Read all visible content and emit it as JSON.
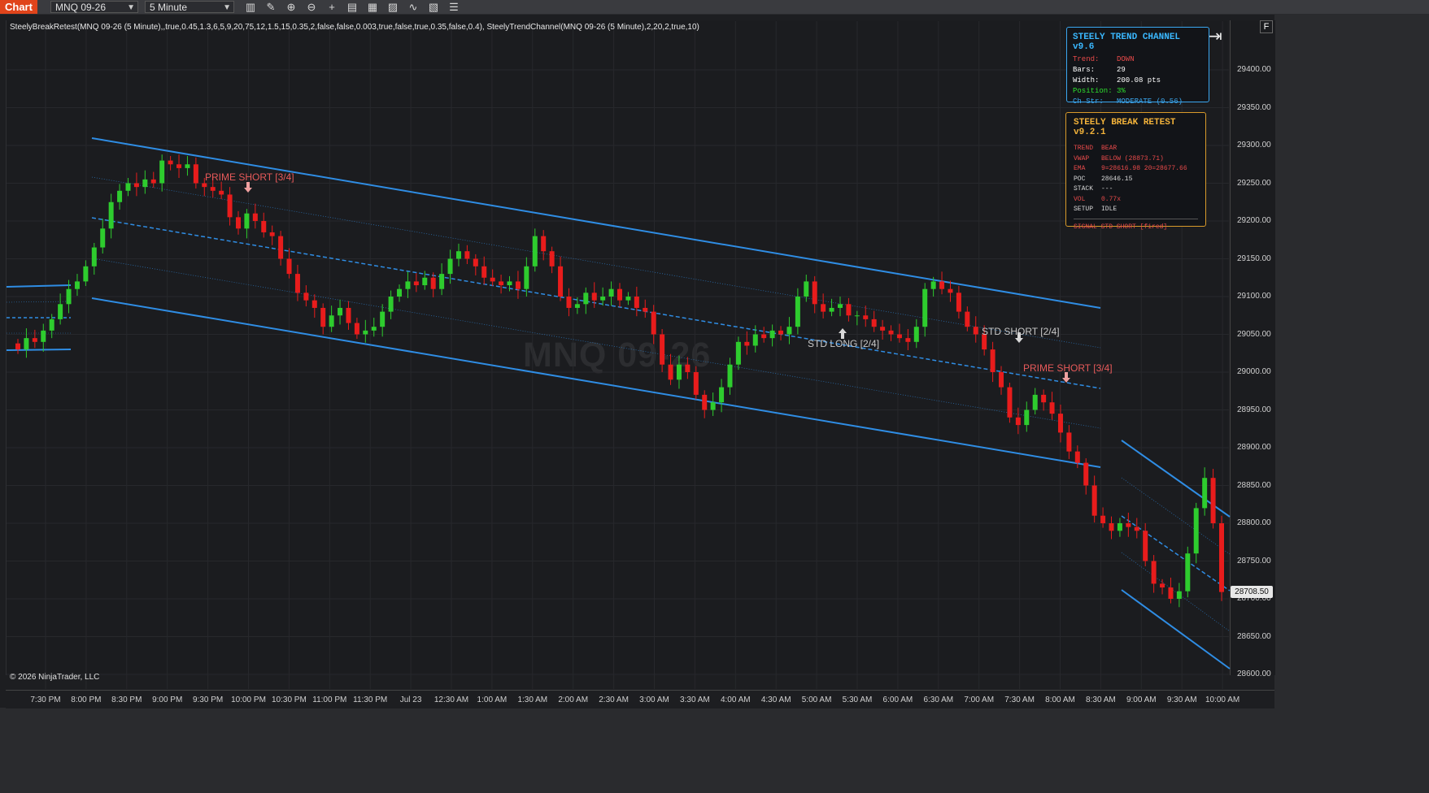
{
  "toolbar": {
    "chart_tab": "Chart",
    "instrument": "MNQ 09-26",
    "interval": "5 Minute",
    "icons": [
      "bars-type-icon",
      "draw-pencil-icon",
      "zoom-in-icon",
      "zoom-out-icon",
      "crosshair-icon",
      "data-box-icon",
      "templates-icon",
      "strategies-icon",
      "indicators-icon",
      "properties-icon",
      "menu-icon"
    ]
  },
  "chart": {
    "indicator_params": "SteelyBreakRetest(MNQ 09-26 (5 Minute),,true,0.45,1.3,6,5,9,20,75,12,1.5,15,0.35,2,false,false,0.003,true,false,true,0.35,false,0.4), SteelyTrendChannel(MNQ 09-26 (5 Minute),2,20,2,true,10)",
    "watermark": "MNQ 09-26",
    "copyright": "© 2026 NinjaTrader, LLC",
    "f_button": "F",
    "current_price": "28708.50"
  },
  "colors": {
    "bull": "#2ecc2e",
    "bear": "#e81c1c",
    "channel": "#2f8de4",
    "trend_panel_border": "#3aa7f0",
    "break_panel_border": "#d89a2a"
  },
  "trend_channel_panel": {
    "title": "STEELY TREND CHANNEL v9.6",
    "rows": [
      {
        "key": "Trend:",
        "value": "DOWN",
        "color": "#e84a4a"
      },
      {
        "key": "Bars:",
        "value": "29",
        "color": "#ffffff"
      },
      {
        "key": "Width:",
        "value": "200.08 pts",
        "color": "#ffffff"
      },
      {
        "key": "Position:",
        "value": "3%",
        "color": "#2ee02e"
      },
      {
        "key": "Ch Str:",
        "value": "MODERATE (0.56)",
        "color": "#3aa7f0"
      }
    ]
  },
  "break_retest_panel": {
    "title": "STEELY BREAK RETEST v9.2.1",
    "rows": [
      {
        "key": "TREND",
        "value": "BEAR"
      },
      {
        "key": "VWAP",
        "value": "BELOW  (28873.71)"
      },
      {
        "key": "EMA",
        "value": "9=28616.98 20=28677.66"
      },
      {
        "key": "POC",
        "value": "28646.15"
      },
      {
        "key": "STACK",
        "value": "---"
      },
      {
        "key": "VOL",
        "value": "0.77x"
      },
      {
        "key": "SETUP",
        "value": "IDLE"
      }
    ],
    "signal": "SIGNAL STD SHORT [fired]"
  },
  "signals": [
    {
      "label": "PRIME SHORT [3/4]",
      "color": "#e85a5a",
      "dir": "down"
    },
    {
      "label": "STD LONG [2/4]",
      "color": "#c8c8c8",
      "dir": "up"
    },
    {
      "label": "STD SHORT [2/4]",
      "color": "#c8c8c8",
      "dir": "down"
    },
    {
      "label": "PRIME SHORT [3/4]",
      "color": "#e85a5a",
      "dir": "down"
    }
  ],
  "price_axis": [
    "29400.00",
    "29350.00",
    "29300.00",
    "29250.00",
    "29200.00",
    "29150.00",
    "29100.00",
    "29050.00",
    "29000.00",
    "28950.00",
    "28900.00",
    "28850.00",
    "28800.00",
    "28750.00",
    "28700.00",
    "28650.00",
    "28600.00"
  ],
  "time_axis": [
    "7:30 PM",
    "8:00 PM",
    "8:30 PM",
    "9:00 PM",
    "9:30 PM",
    "10:00 PM",
    "10:30 PM",
    "11:00 PM",
    "11:30 PM",
    "Jul 23",
    "12:30 AM",
    "1:00 AM",
    "1:30 AM",
    "2:00 AM",
    "2:30 AM",
    "3:00 AM",
    "3:30 AM",
    "4:00 AM",
    "4:30 AM",
    "5:00 AM",
    "5:30 AM",
    "6:00 AM",
    "6:30 AM",
    "7:00 AM",
    "7:30 AM",
    "8:00 AM",
    "8:30 AM",
    "9:00 AM",
    "9:30 AM",
    "10:00 AM"
  ],
  "chart_data": {
    "type": "candlestick",
    "instrument": "MNQ 09-26",
    "interval": "5 Minute",
    "ylim": [
      28590,
      29440
    ],
    "closes": [
      29030,
      29045,
      29040,
      29055,
      29070,
      29090,
      29110,
      29120,
      29140,
      29165,
      29190,
      29225,
      29240,
      29250,
      29245,
      29255,
      29250,
      29280,
      29275,
      29270,
      29275,
      29250,
      29245,
      29240,
      29235,
      29205,
      29190,
      29210,
      29200,
      29185,
      29180,
      29150,
      29130,
      29105,
      29095,
      29085,
      29060,
      29075,
      29085,
      29065,
      29050,
      29055,
      29060,
      29080,
      29100,
      29110,
      29120,
      29115,
      29125,
      29110,
      29130,
      29150,
      29160,
      29150,
      29140,
      29125,
      29120,
      29115,
      29120,
      29110,
      29140,
      29180,
      29160,
      29140,
      29100,
      29085,
      29090,
      29105,
      29095,
      29100,
      29110,
      29095,
      29100,
      29085,
      29080,
      29050,
      29010,
      28990,
      29010,
      29000,
      28970,
      28950,
      28960,
      28980,
      29010,
      29040,
      29035,
      29050,
      29045,
      29055,
      29050,
      29060,
      29100,
      29120,
      29090,
      29080,
      29085,
      29090,
      29075,
      29075,
      29070,
      29060,
      29055,
      29050,
      29045,
      29040,
      29060,
      29110,
      29120,
      29110,
      29105,
      29080,
      29060,
      29050,
      29030,
      29000,
      28980,
      28940,
      28930,
      28950,
      28970,
      28960,
      28945,
      28920,
      28895,
      28880,
      28850,
      28810,
      28800,
      28790,
      28800,
      28795,
      28790,
      28750,
      28720,
      28715,
      28700,
      28710,
      28760,
      28820,
      28860,
      28800,
      28709
    ]
  }
}
